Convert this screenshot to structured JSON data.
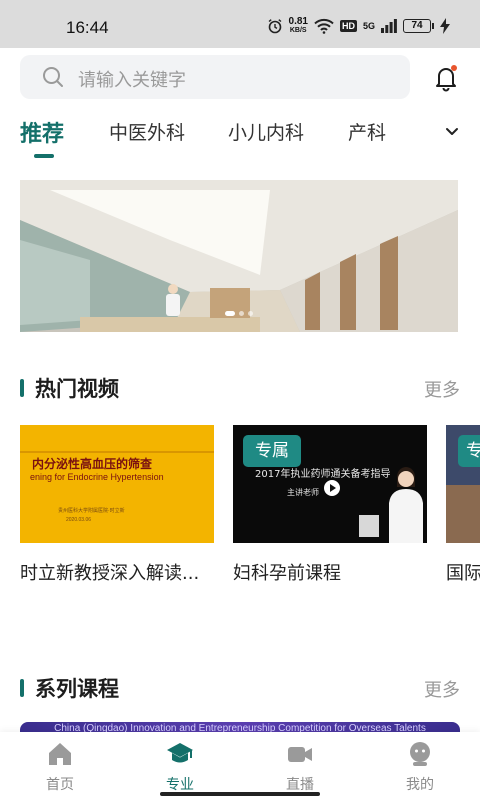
{
  "status_bar": {
    "time": "16:44",
    "net_speed": "0.81",
    "net_unit": "KB/S",
    "hd": "HD",
    "network": "5G",
    "battery": "74"
  },
  "search": {
    "placeholder": "请输入关键字"
  },
  "tabs": [
    "推荐",
    "中医外科",
    "小儿内科",
    "产科"
  ],
  "hot_videos": {
    "title": "热门视频",
    "more": "更多",
    "items": [
      {
        "title": "时立新教授深入解读...",
        "thumb_heading": "内分泌性高血压的筛查",
        "thumb_sub": "ening for Endocrine Hypertension",
        "thumb_org": "贵州医科大学附属医院·时立新",
        "thumb_date": "2020.03.06"
      },
      {
        "title": "妇科孕前课程",
        "badge": "专属",
        "thumb_heading": "2017年执业药师通关备考指导",
        "thumb_sub": "主讲老师"
      },
      {
        "title": "国际",
        "badge": "专"
      }
    ]
  },
  "series": {
    "title": "系列课程",
    "more": "更多",
    "banner_text": "China (Qingdao) Innovation and Entrepreneurship Competition for Overseas Talents"
  },
  "bottom_nav": [
    {
      "label": "首页",
      "icon": "home-icon"
    },
    {
      "label": "专业",
      "icon": "graduation-cap-icon",
      "active": true
    },
    {
      "label": "直播",
      "icon": "video-camera-icon"
    },
    {
      "label": "我的",
      "icon": "user-icon"
    }
  ],
  "colors": {
    "accent": "#14706a",
    "badge": "#1f8a84",
    "notification": "#e8552d"
  }
}
